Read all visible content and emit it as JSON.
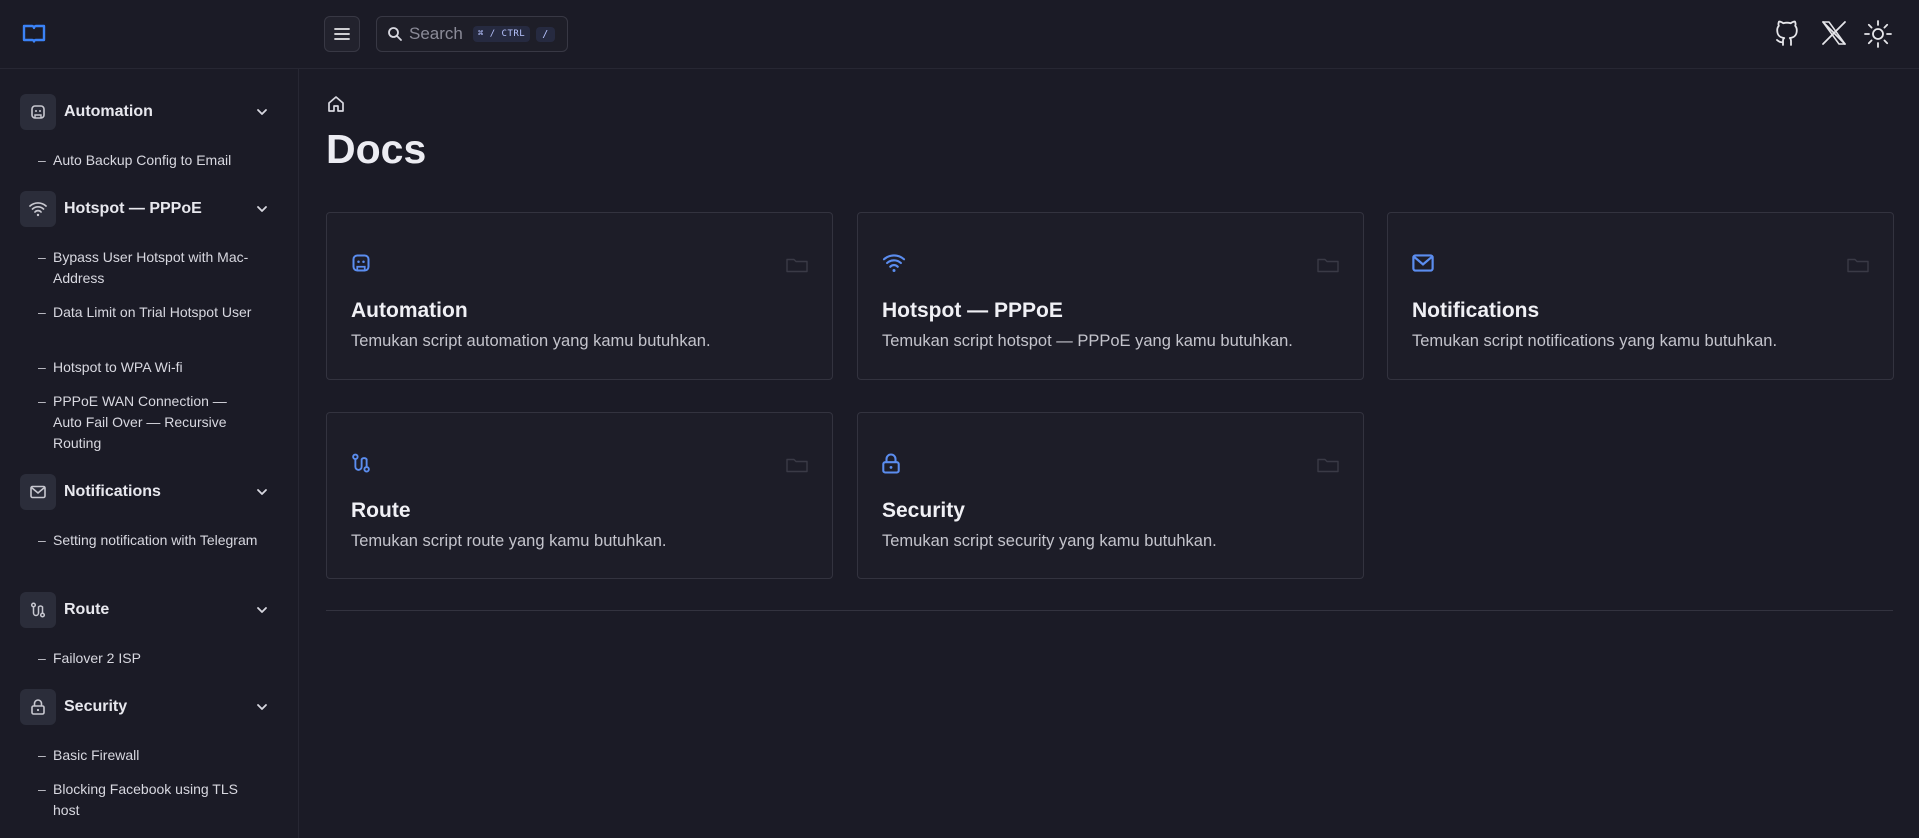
{
  "header": {
    "search_placeholder": "Search",
    "kbd_primary": "⌘ / CTRL",
    "kbd_secondary": "/"
  },
  "sidebar": {
    "sections": [
      {
        "label": "Automation",
        "icon": "robot-icon",
        "items": [
          "Auto Backup Config to Email"
        ]
      },
      {
        "label": "Hotspot — PPPoE",
        "icon": "wifi-icon",
        "items": [
          "Bypass User Hotspot with Mac-Address",
          "Data Limit on Trial Hotspot User",
          "Hotspot to WPA Wi-fi",
          "PPPoE WAN Connection — Auto Fail Over — Recursive Routing"
        ]
      },
      {
        "label": "Notifications",
        "icon": "mail-icon",
        "items": [
          "Setting notification with Telegram"
        ]
      },
      {
        "label": "Route",
        "icon": "route-icon",
        "items": [
          "Failover 2 ISP"
        ]
      },
      {
        "label": "Security",
        "icon": "lock-icon",
        "items": [
          "Basic Firewall",
          "Blocking Facebook using TLS host"
        ]
      }
    ]
  },
  "main": {
    "title": "Docs",
    "cards": [
      {
        "title": "Automation",
        "desc": "Temukan script automation yang kamu butuhkan.",
        "icon": "robot-icon"
      },
      {
        "title": "Hotspot — PPPoE",
        "desc": "Temukan script hotspot — PPPoE yang kamu butuhkan.",
        "icon": "wifi-icon"
      },
      {
        "title": "Notifications",
        "desc": "Temukan script notifications yang kamu butuhkan.",
        "icon": "mail-icon"
      },
      {
        "title": "Route",
        "desc": "Temukan script route yang kamu butuhkan.",
        "icon": "route-icon"
      },
      {
        "title": "Security",
        "desc": "Temukan script security yang kamu butuhkan.",
        "icon": "lock-icon"
      }
    ]
  },
  "colors": {
    "accent": "#3b82f6",
    "background": "#1b1b26",
    "card_border": "#33333f"
  }
}
